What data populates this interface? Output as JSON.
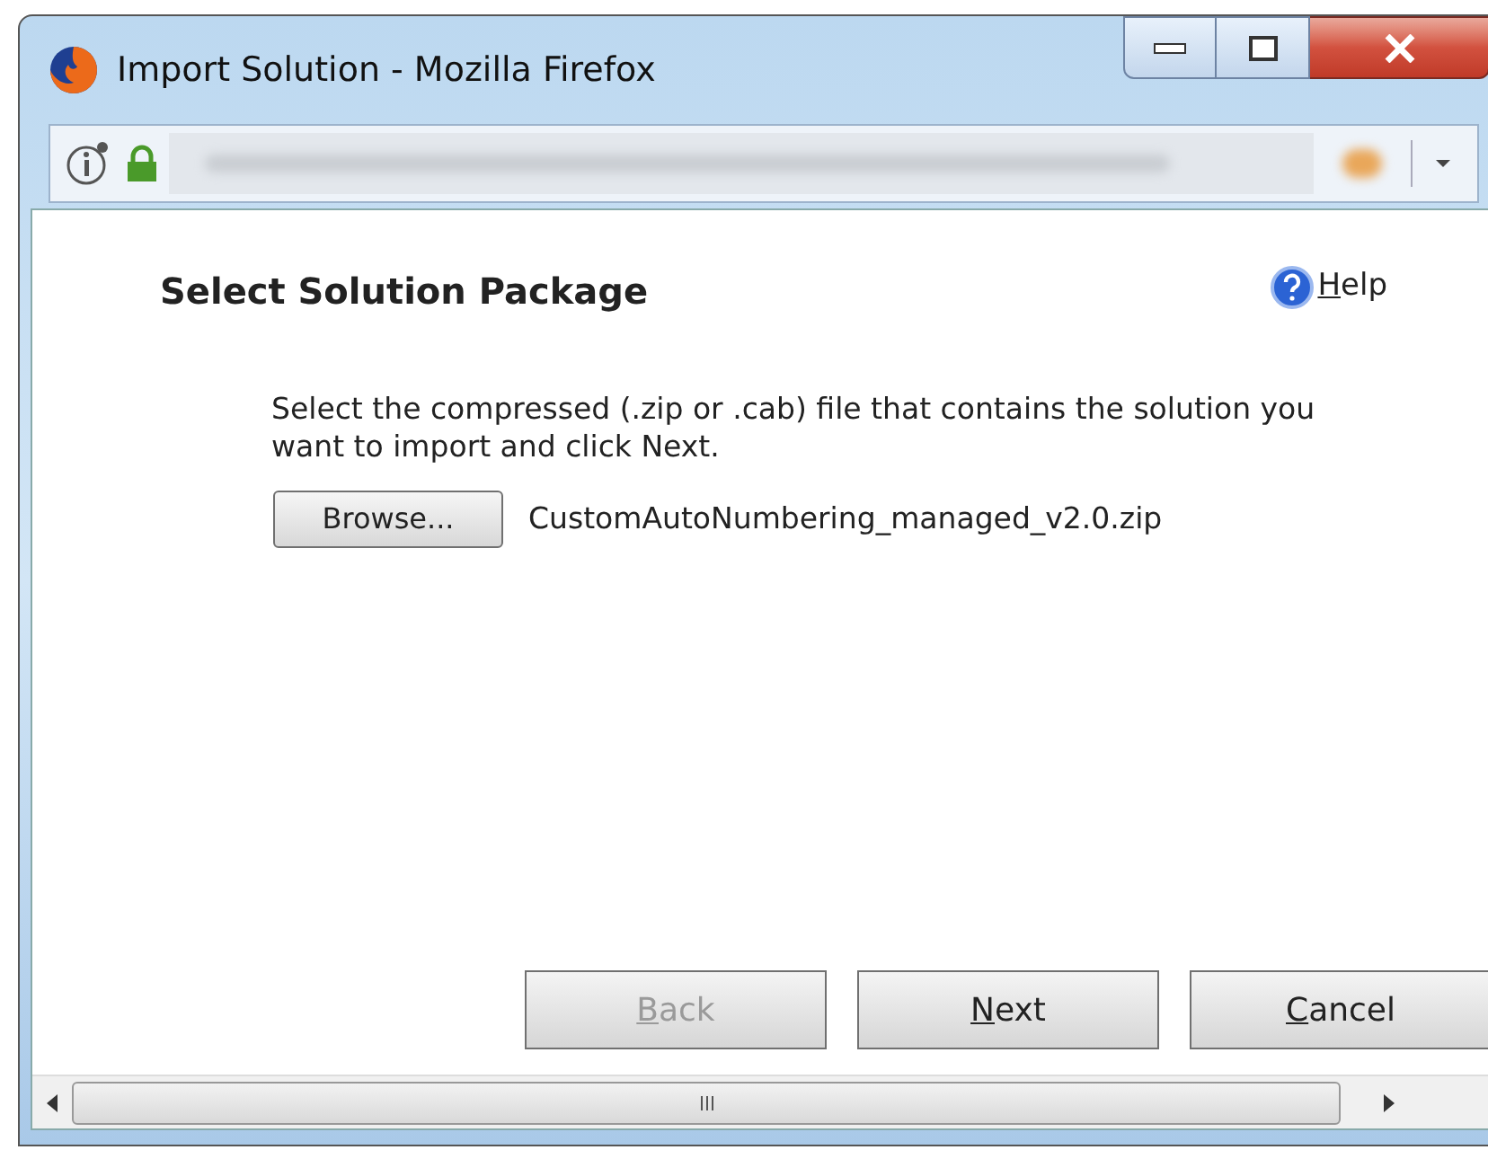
{
  "window": {
    "title": "Import Solution - Mozilla Firefox"
  },
  "dialog": {
    "heading": "Select Solution Package",
    "help": {
      "mnemonic": "H",
      "rest": "elp"
    },
    "instructions": "Select the compressed (.zip or .cab) file that contains the solution you want to import and click Next.",
    "browse_button": "Browse...",
    "file_name": "CustomAutoNumbering_managed_v2.0.zip"
  },
  "buttons": [
    {
      "mnemonic": "B",
      "rest": "ack",
      "disabled": true
    },
    {
      "mnemonic": "N",
      "rest": "ext",
      "disabled": false
    },
    {
      "mnemonic": "C",
      "rest": "ancel",
      "disabled": false
    }
  ]
}
